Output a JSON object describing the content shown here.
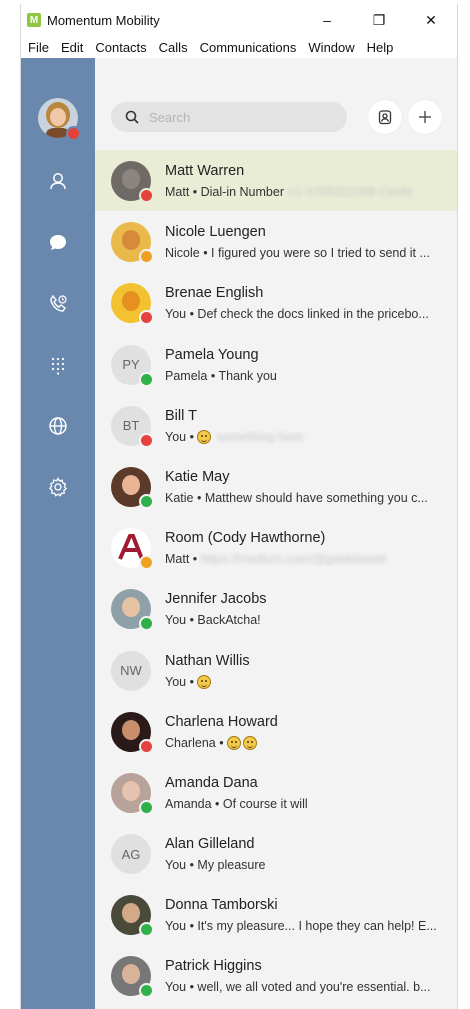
{
  "window": {
    "title": "Momentum Mobility",
    "logo_letter": "M",
    "accent": "#8dc63f",
    "controls": [
      "–",
      "❐",
      "✕"
    ]
  },
  "menu": [
    "File",
    "Edit",
    "Contacts",
    "Calls",
    "Communications",
    "Window",
    "Help"
  ],
  "sidebar": {
    "color": "#6a88ae",
    "me_status": "busy",
    "nav": [
      {
        "icon": "contacts-icon"
      },
      {
        "icon": "chat-icon"
      },
      {
        "icon": "phone-icon"
      },
      {
        "icon": "dialpad-icon"
      },
      {
        "icon": "globe-icon"
      },
      {
        "icon": "settings-icon"
      }
    ]
  },
  "search": {
    "placeholder": "Search",
    "value": ""
  },
  "conversations": [
    {
      "name": "Matt Warren",
      "preview_prefix": "Matt • Dial-in Number",
      "preview_blurred": "+1-4706321008 Confe",
      "avatar": "photo",
      "status": "busy",
      "active": true
    },
    {
      "name": "Nicole Luengen",
      "preview_prefix": "Nicole • I figured you were so I tried to send it ...",
      "avatar": "photo",
      "status": "away"
    },
    {
      "name": "Brenae English",
      "preview_prefix": "You • Def check the docs linked in the pricebo...",
      "avatar": "photo",
      "status": "busy"
    },
    {
      "name": "Pamela Young",
      "preview_prefix": "Pamela • Thank you",
      "avatar": "initials",
      "initials": "PY",
      "status": "available"
    },
    {
      "name": "Bill T",
      "preview_prefix": "You •",
      "emoji": 1,
      "preview_blurred": "something here",
      "avatar": "initials",
      "initials": "BT",
      "status": "busy"
    },
    {
      "name": "Katie May",
      "preview_prefix": "Katie • Matthew should have something you c...",
      "avatar": "photo",
      "status": "available"
    },
    {
      "name": "Room (Cody Hawthorne)",
      "preview_prefix": "Matt •",
      "preview_blurred": "https://medium.com/@geekinavet",
      "avatar": "logo",
      "status": "away"
    },
    {
      "name": "Jennifer Jacobs",
      "preview_prefix": "You • BackAtcha!",
      "avatar": "photo",
      "status": "available"
    },
    {
      "name": "Nathan Willis",
      "preview_prefix": "You •",
      "emoji": 1,
      "avatar": "initials",
      "initials": "NW"
    },
    {
      "name": "Charlena Howard",
      "preview_prefix": "Charlena •",
      "emoji": 2,
      "avatar": "photo",
      "status": "busy"
    },
    {
      "name": "Amanda Dana",
      "preview_prefix": "Amanda • Of course it will",
      "avatar": "photo",
      "status": "available"
    },
    {
      "name": "Alan Gilleland",
      "preview_prefix": "You • My pleasure",
      "avatar": "initials",
      "initials": "AG"
    },
    {
      "name": "Donna Tamborski",
      "preview_prefix": "You • It's my pleasure... I hope they can help! E...",
      "avatar": "photo",
      "status": "available"
    },
    {
      "name": "Patrick Higgins",
      "preview_prefix": "You • well, we all voted and you're essential. b...",
      "avatar": "photo",
      "status": "available"
    }
  ],
  "status_colors": {
    "busy": "#e5413d",
    "away": "#f0a020",
    "available": "#2fb14a"
  }
}
